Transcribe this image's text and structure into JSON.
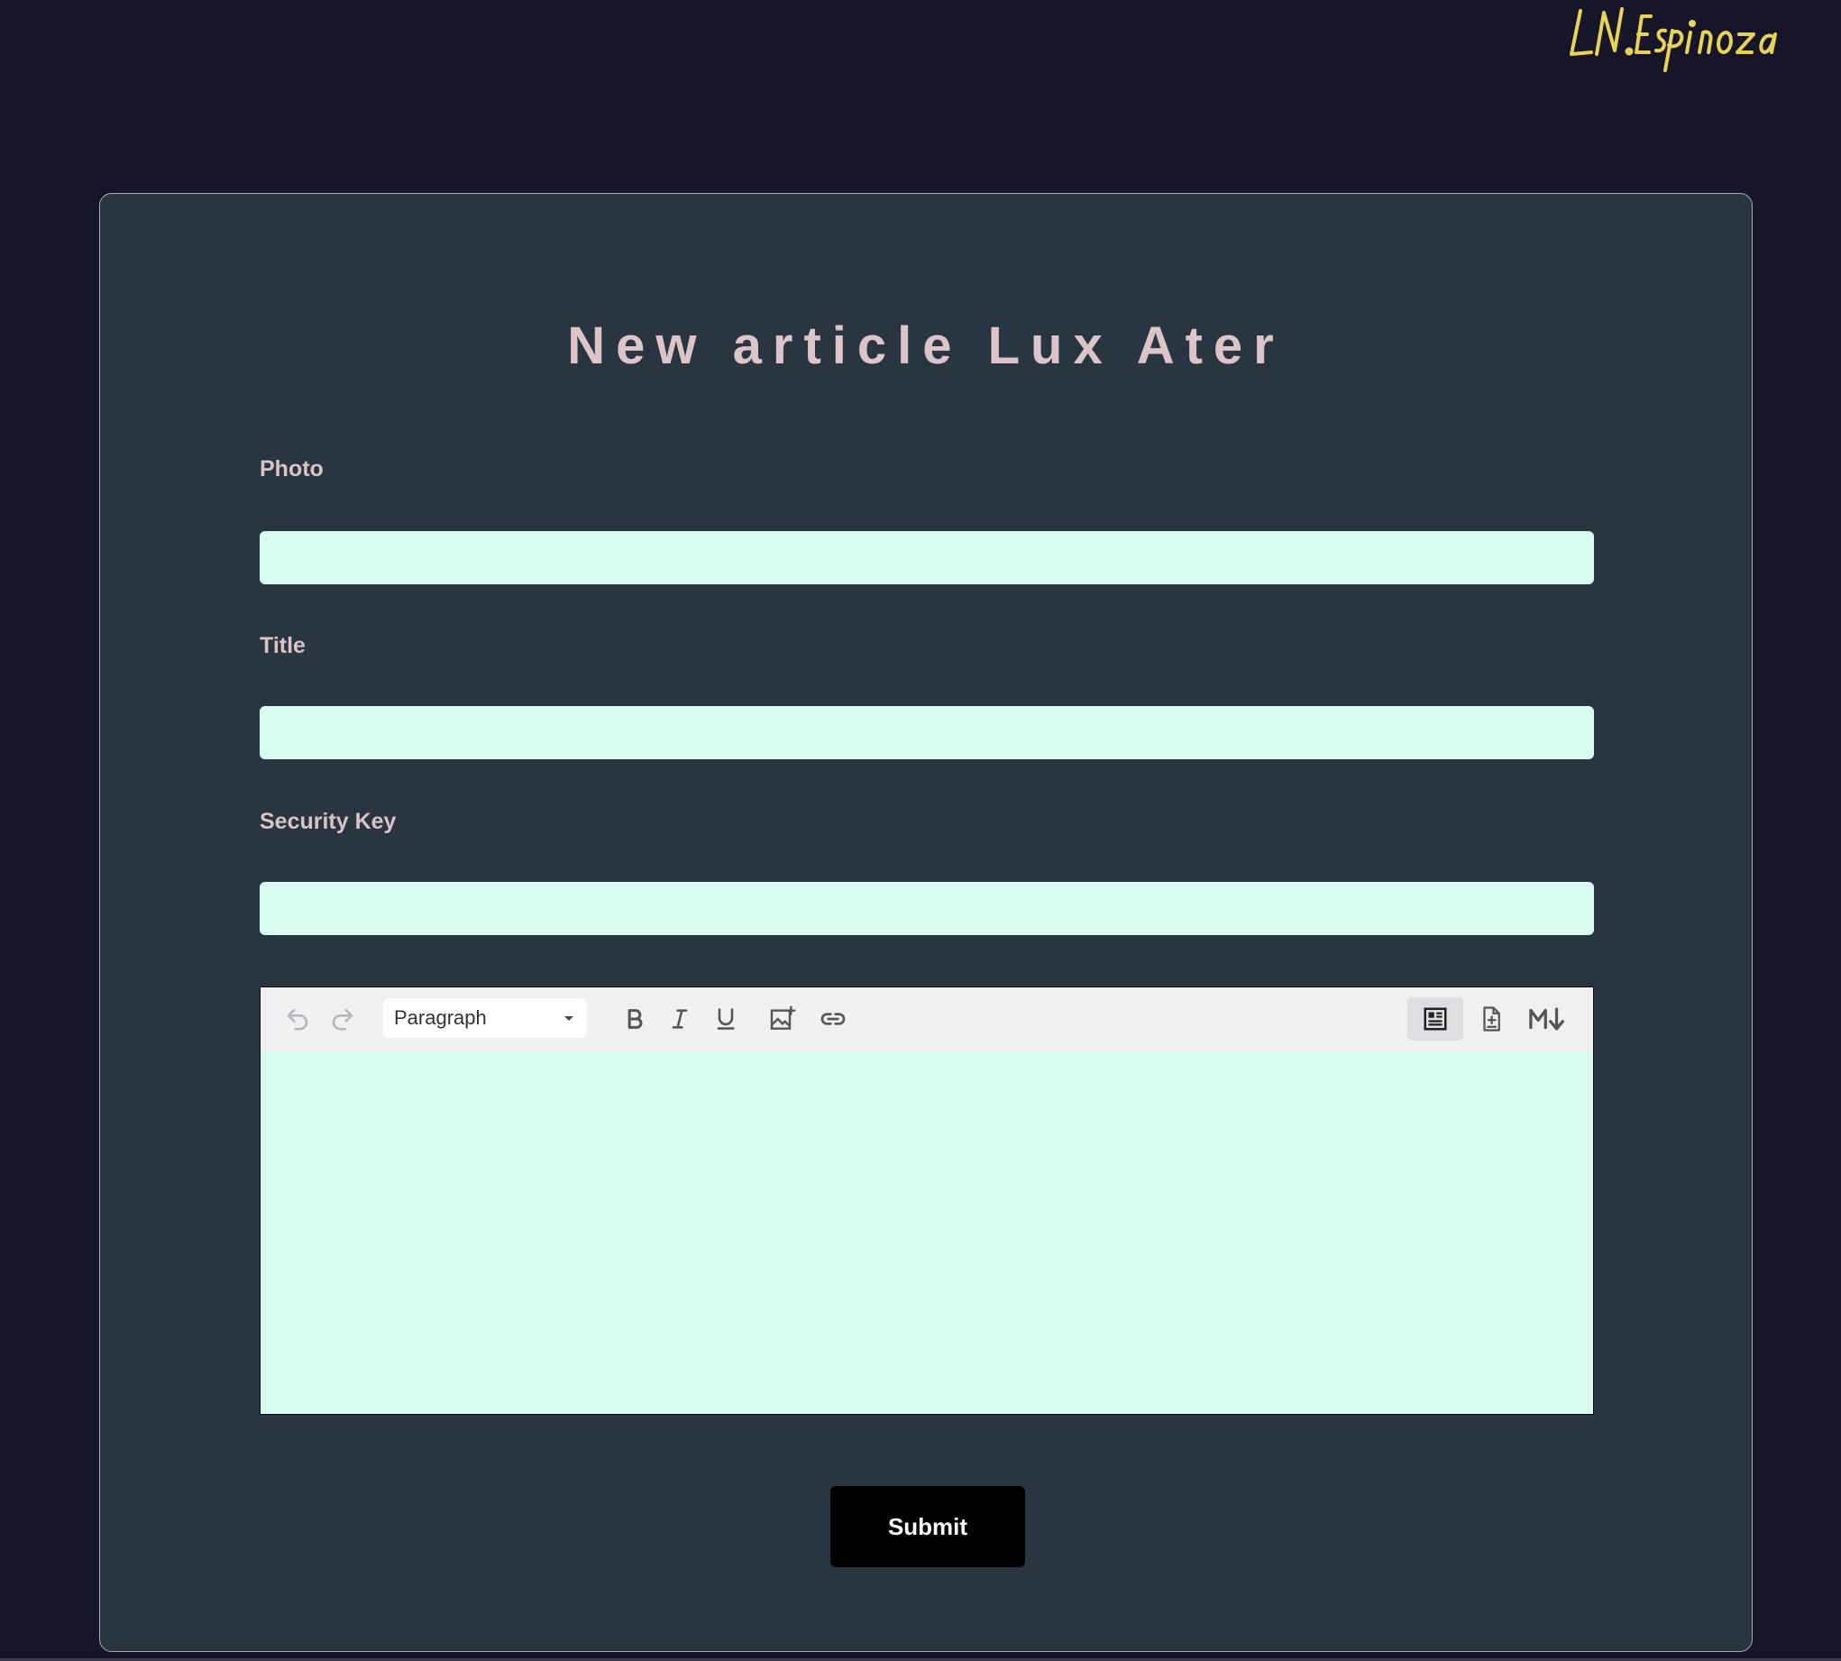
{
  "logo": {
    "text": "LN.Espinoza",
    "color": "#e6d35a"
  },
  "form": {
    "title": "New article Lux Ater",
    "fields": [
      {
        "label": "Photo",
        "value": "",
        "placeholder": ""
      },
      {
        "label": "Title",
        "value": "",
        "placeholder": ""
      },
      {
        "label": "Security Key",
        "value": "",
        "placeholder": ""
      }
    ],
    "editor": {
      "block_format": "Paragraph",
      "content": "",
      "toolbar_icons": [
        "undo-icon",
        "redo-icon",
        "bold-icon",
        "italic-icon",
        "underline-icon",
        "insert-image-icon",
        "link-icon",
        "rich-text-mode-icon",
        "source-mode-icon",
        "markdown-mode-icon"
      ]
    },
    "submit_label": "Submit"
  },
  "colors": {
    "background": "#161628",
    "card": "#2a3542",
    "label": "#d9c3c6",
    "input": "#dafcf0"
  }
}
